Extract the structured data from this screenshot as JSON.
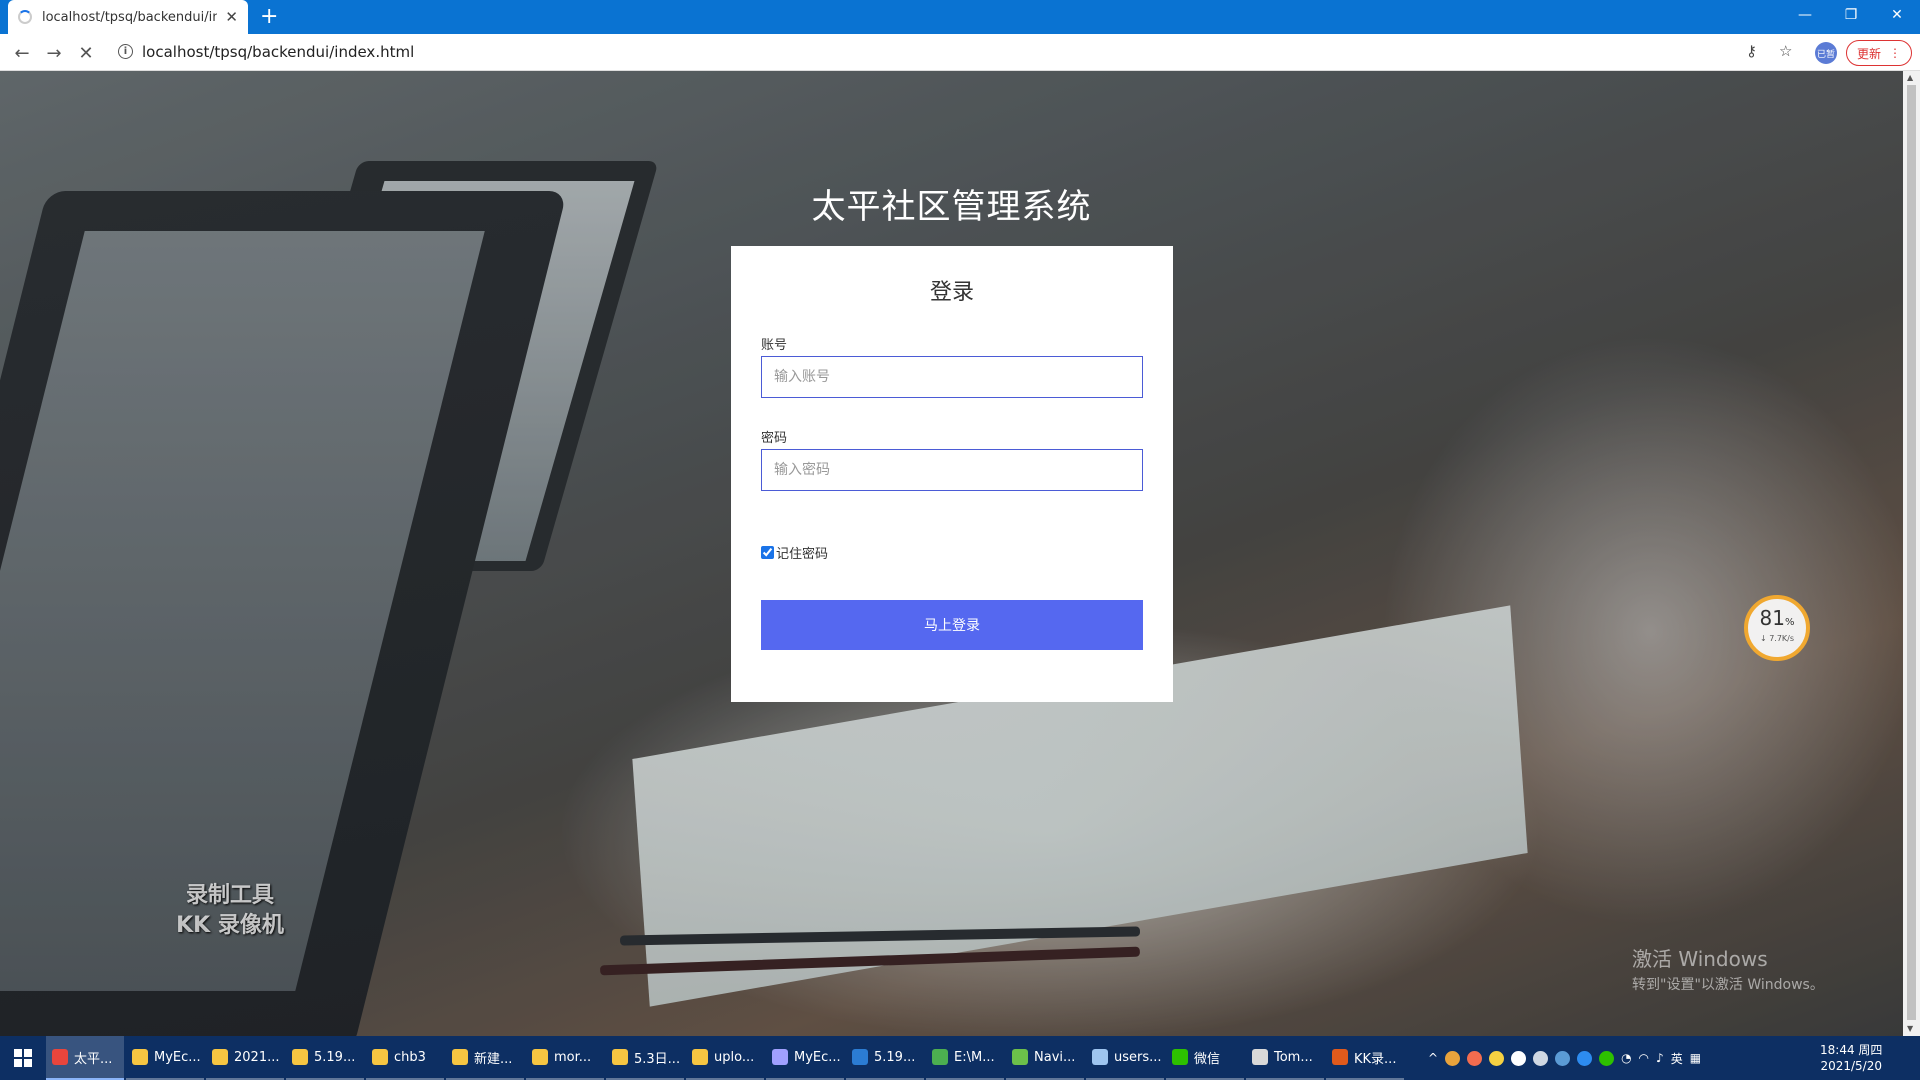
{
  "browser": {
    "tab_title": "localhost/tpsq/backendui/index.html",
    "url": "localhost/tpsq/backendui/index.html",
    "update_label": "更新",
    "profile_label": "已暂"
  },
  "page": {
    "system_title": "太平社区管理系统",
    "login": {
      "heading": "登录",
      "account_label": "账号",
      "account_placeholder": "输入账号",
      "password_label": "密码",
      "password_placeholder": "输入密码",
      "remember_label": "记住密码",
      "remember_checked": true,
      "submit_label": "马上登录"
    }
  },
  "overlays": {
    "speed_percent": "81",
    "speed_unit": "%",
    "speed_rate": "↓ 7.7K/s",
    "kk_line1": "录制工具",
    "kk_line2": "KK 录像机",
    "activate_line1": "激活 Windows",
    "activate_line2": "转到\"设置\"以激活 Windows。"
  },
  "taskbar": {
    "items": [
      {
        "label": "太平...",
        "color": "#e8453c"
      },
      {
        "label": "MyEc...",
        "color": "#f5c542"
      },
      {
        "label": "2021...",
        "color": "#f5c542"
      },
      {
        "label": "5.19...",
        "color": "#f5c542"
      },
      {
        "label": "chb3",
        "color": "#f5c542"
      },
      {
        "label": "新建...",
        "color": "#f5c542"
      },
      {
        "label": "mor...",
        "color": "#f5c542"
      },
      {
        "label": "5.3日...",
        "color": "#f5c542"
      },
      {
        "label": "uplo...",
        "color": "#f5c542"
      },
      {
        "label": "MyEc...",
        "color": "#a0a0ff"
      },
      {
        "label": "5.19...",
        "color": "#2b7cd3"
      },
      {
        "label": "E:\\M...",
        "color": "#4caf50"
      },
      {
        "label": "Navi...",
        "color": "#6cc04a"
      },
      {
        "label": "users...",
        "color": "#9ec5f0"
      },
      {
        "label": "微信",
        "color": "#2dc100"
      },
      {
        "label": "Tom...",
        "color": "#d9d9d9"
      },
      {
        "label": "KK录...",
        "color": "#e05a1c"
      }
    ],
    "ime": "英",
    "time": "18:44 周四",
    "date": "2021/5/20"
  }
}
